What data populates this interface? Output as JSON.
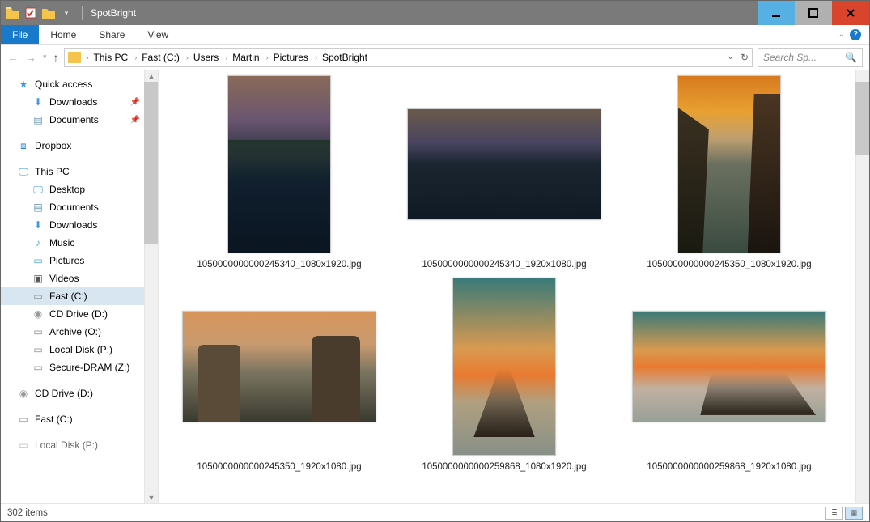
{
  "window": {
    "title": "SpotBright"
  },
  "ribbon": {
    "file": "File",
    "home": "Home",
    "share": "Share",
    "view": "View"
  },
  "breadcrumbs": {
    "p0": "This PC",
    "p1": "Fast (C:)",
    "p2": "Users",
    "p3": "Martin",
    "p4": "Pictures",
    "p5": "SpotBright"
  },
  "search": {
    "placeholder": "Search Sp..."
  },
  "nav": {
    "quick": "Quick access",
    "downloads": "Downloads",
    "documents": "Documents",
    "dropbox": "Dropbox",
    "thispc": "This PC",
    "desktop": "Desktop",
    "documents2": "Documents",
    "downloads2": "Downloads",
    "music": "Music",
    "pictures": "Pictures",
    "videos": "Videos",
    "fastc": "Fast (C:)",
    "cdd": "CD Drive (D:)",
    "archo": "Archive (O:)",
    "localp": "Local Disk (P:)",
    "securez": "Secure-DRAM (Z:)",
    "cdd2": "CD Drive (D:)",
    "fastc2": "Fast (C:)",
    "localp2": "Local Disk (P:)"
  },
  "files": {
    "f1": "1050000000000245340_1080x1920.jpg",
    "f2": "1050000000000245340_1920x1080.jpg",
    "f3": "1050000000000245350_1080x1920.jpg",
    "f4": "1050000000000245350_1920x1080.jpg",
    "f5": "1050000000000259868_1080x1920.jpg",
    "f6": "1050000000000259868_1920x1080.jpg"
  },
  "status": {
    "count": "302 items"
  }
}
